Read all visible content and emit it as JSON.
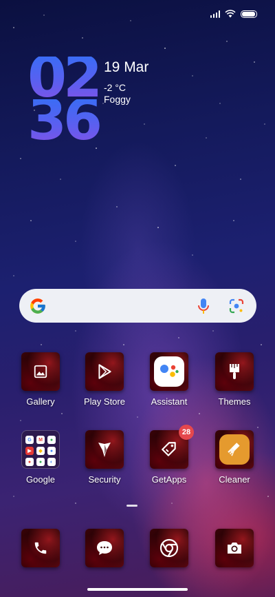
{
  "clock": {
    "hours": "02",
    "minutes": "36"
  },
  "weather": {
    "date": "19 Mar",
    "temperature": "-2 °C",
    "condition": "Foggy"
  },
  "status_bar": {
    "battery_level": 0.95,
    "signal_bars": 4
  },
  "search": {
    "icons": [
      "google-g-icon",
      "microphone-icon",
      "google-lens-icon"
    ]
  },
  "apps": {
    "gallery": {
      "label": "Gallery",
      "icon": "image-icon"
    },
    "play_store": {
      "label": "Play Store",
      "icon": "play-triangle-icon"
    },
    "assistant": {
      "label": "Assistant",
      "icon": "assistant-dots-icon"
    },
    "themes": {
      "label": "Themes",
      "icon": "paintbrush-icon"
    },
    "google": {
      "label": "Google",
      "icon": "folder-icon"
    },
    "security": {
      "label": "Security",
      "icon": "shield-icon"
    },
    "getapps": {
      "label": "GetApps",
      "icon": "tag-icon",
      "badge": "28"
    },
    "cleaner": {
      "label": "Cleaner",
      "icon": "broom-icon"
    }
  },
  "dock": {
    "phone": {
      "icon": "phone-icon"
    },
    "messages": {
      "icon": "chat-bubble-icon"
    },
    "chrome": {
      "icon": "chrome-icon"
    },
    "camera": {
      "icon": "camera-icon"
    }
  },
  "colors": {
    "clock_gradient_top": "#3b6cf5",
    "clock_gradient_bottom": "#7a55e8",
    "badge": "#e5484d",
    "search_bg": "#eef0f5"
  }
}
